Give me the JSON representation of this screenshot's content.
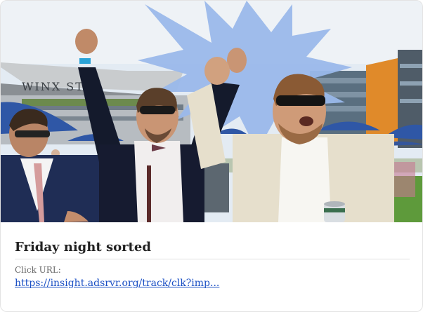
{
  "ad": {
    "headline": "Friday night sorted",
    "url_label": "Click URL:",
    "url_text": "https://insight.adsrvr.org/track/clk?imp...",
    "image": {
      "venue_sign": "WINX STA",
      "description_icon": "celebrating-race-crowd-photo"
    }
  },
  "colors": {
    "burst": "#9ab8ea",
    "link": "#1a4fc4",
    "sky": "#dfe8f1",
    "umbrella": "#2f57a6",
    "grass": "#5e9a3b",
    "building_orange": "#e08a2a"
  }
}
